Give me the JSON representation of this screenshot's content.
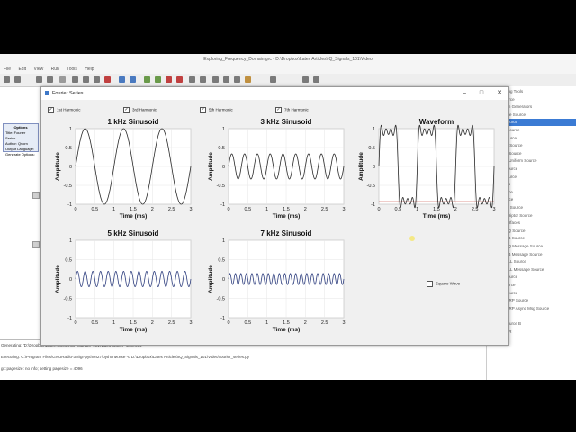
{
  "grc": {
    "title": "Exploring_Frequency_Domain.grc - D:\\Dropbox\\Latex Articles\\IQ_Signals_101\\Video",
    "menu": [
      "File",
      "Edit",
      "View",
      "Run",
      "Tools",
      "Help"
    ],
    "options_block": {
      "title": "Options",
      "lines": [
        "Title: Fourier Series",
        "Author: Qsorn",
        "Output Language:",
        "Generate Options:"
      ]
    },
    "console": [
      "Generating: 'D:\\Dropbox\\Latex Articles\\IQ_Signals_101\\Video\\fourier_series.py'",
      "Executing: C:\\Program Files\\GNURadio-3.8\\gr-python27\\pythonw.exe -u D:\\Dropbox\\Latex Articles\\IQ_Signals_101\\Video\\fourier_series.py",
      "gr::pagesize: no info; setting pagesize = 4096"
    ],
    "block_tree": [
      {
        "label": "Networking Tools",
        "selected": false
      },
      {
        "label": "SDP Source",
        "selected": false
      },
      {
        "label": "Waveform Generators",
        "selected": false
      },
      {
        "label": "Fast Noise Source",
        "selected": false
      },
      {
        "label": "Signal Source",
        "selected": true
      },
      {
        "label": "GLFSR Source",
        "selected": false
      },
      {
        "label": "Noise Source",
        "selected": false
      },
      {
        "label": "Constant Source",
        "selected": false
      },
      {
        "label": "Random Source",
        "selected": false
      },
      {
        "label": "Random Uniform Source",
        "selected": false
      },
      {
        "label": "Vector Source",
        "selected": false
      },
      {
        "label": "Audio Source",
        "selected": false
      },
      {
        "label": "Operators",
        "selected": false
      },
      {
        "label": "File Source",
        "selected": false
      },
      {
        "label": "Null Source",
        "selected": false
      },
      {
        "label": "File Meta Source",
        "selected": false
      },
      {
        "label": "File Descriptor Source",
        "selected": false
      },
      {
        "label": "ZMQ Interfaces",
        "selected": false
      },
      {
        "label": "ZMQ REQ Source",
        "selected": false
      },
      {
        "label": "ZMQ SUB Source",
        "selected": false
      },
      {
        "label": "ZMQ REQ Message Source",
        "selected": false
      },
      {
        "label": "ZMQ SUB Message Source",
        "selected": false
      },
      {
        "label": "ZMQ PULL Source",
        "selected": false
      },
      {
        "label": "ZMQ PULL Message Source",
        "selected": false
      },
      {
        "label": "Virtual Source",
        "selected": false
      },
      {
        "label": "Input Source",
        "selected": false
      },
      {
        "label": "Vector Source",
        "selected": false
      },
      {
        "label": "UHD: USRP Source",
        "selected": false
      },
      {
        "label": "UHD: USRP Async Msg Source",
        "selected": false
      },
      {
        "label": "mapper",
        "selected": false
      },
      {
        "label": "PRBS Source B",
        "selected": false
      },
      {
        "label": "OsmoSDR",
        "selected": false
      }
    ]
  },
  "fourier_window": {
    "title": "Fourier Series",
    "minimize": "–",
    "maximize": "□",
    "close": "✕",
    "checkboxes": [
      {
        "label": "1st Harmonic",
        "checked": true
      },
      {
        "label": "3rd Harmonic",
        "checked": true
      },
      {
        "label": "5th Harmonic",
        "checked": true
      },
      {
        "label": "7th Harmonic",
        "checked": true
      }
    ],
    "square_wave_checkbox": {
      "label": "Square Wave",
      "checked": false
    }
  },
  "chart_data": [
    {
      "type": "line",
      "title": "1 kHz Sinusoid",
      "xlabel": "Time (ms)",
      "ylabel": "Amplitude",
      "xlim": [
        0,
        3
      ],
      "ylim": [
        -1,
        1
      ],
      "xticks": [
        "0",
        "0.5",
        "1",
        "1.5",
        "2",
        "2.5",
        "3"
      ],
      "yticks": [
        "1",
        "0.5",
        "0",
        "-0.5",
        "-1"
      ],
      "harmonic": 1,
      "amplitude": 1,
      "color": "#2a2a2a",
      "grid": true
    },
    {
      "type": "line",
      "title": "3 kHz Sinusoid",
      "xlabel": "Time (ms)",
      "ylabel": "Amplitude",
      "xlim": [
        0,
        3
      ],
      "ylim": [
        -1,
        1
      ],
      "xticks": [
        "0",
        "0.5",
        "1",
        "1.5",
        "2",
        "2.5",
        "3"
      ],
      "yticks": [
        "1",
        "0.5",
        "0",
        "-0.5",
        "-1"
      ],
      "harmonic": 3,
      "amplitude": 0.333,
      "color": "#2a2a2a",
      "grid": true
    },
    {
      "type": "line",
      "title": "Waveform",
      "xlabel": "Time (ms)",
      "ylabel": "Amplitude",
      "xlim": [
        0,
        3
      ],
      "ylim": [
        -1,
        1
      ],
      "xticks": [
        "0",
        "0.5",
        "1",
        "1.5",
        "2",
        "2.5",
        "3"
      ],
      "yticks": [
        "1",
        "0.5",
        "0",
        "-0.5",
        "-1"
      ],
      "harmonics": [
        1,
        3,
        5,
        7
      ],
      "color": "#2a2a2a",
      "grid": true,
      "baseline": -0.93,
      "baseline_color": "#c0392b"
    },
    {
      "type": "line",
      "title": "5 kHz Sinusoid",
      "xlabel": "Time (ms)",
      "ylabel": "Amplitude",
      "xlim": [
        0,
        3
      ],
      "ylim": [
        -1,
        1
      ],
      "xticks": [
        "0",
        "0.5",
        "1",
        "1.5",
        "2",
        "2.5",
        "3"
      ],
      "yticks": [
        "1",
        "0.5",
        "0",
        "-0.5",
        "-1"
      ],
      "harmonic": 5,
      "amplitude": 0.2,
      "color": "#2f3f7f",
      "grid": true
    },
    {
      "type": "line",
      "title": "7 kHz Sinusoid",
      "xlabel": "Time (ms)",
      "ylabel": "Amplitude",
      "xlim": [
        0,
        3
      ],
      "ylim": [
        -1,
        1
      ],
      "xticks": [
        "0",
        "0.5",
        "1",
        "1.5",
        "2",
        "2.5",
        "3"
      ],
      "yticks": [
        "1",
        "0.5",
        "0",
        "-0.5",
        "-1"
      ],
      "harmonic": 7,
      "amplitude": 0.143,
      "color": "#2f3f7f",
      "grid": true
    }
  ]
}
